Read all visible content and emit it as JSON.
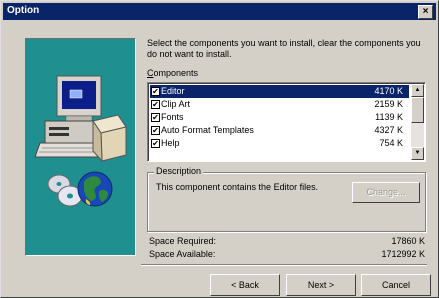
{
  "window": {
    "title": "Option",
    "close_glyph": "×"
  },
  "instructions": "Select the components you want to install, clear the components you do not want to install.",
  "components": {
    "label": "Components",
    "items": [
      {
        "name": "Editor",
        "size": "4170 K",
        "checked": true,
        "selected": true
      },
      {
        "name": "Clip Art",
        "size": "2159 K",
        "checked": true,
        "selected": false
      },
      {
        "name": "Fonts",
        "size": "1139 K",
        "checked": true,
        "selected": false
      },
      {
        "name": "Auto Format Templates",
        "size": "4327 K",
        "checked": true,
        "selected": false
      },
      {
        "name": "Help",
        "size": "754 K",
        "checked": true,
        "selected": false
      }
    ]
  },
  "description": {
    "legend": "Description",
    "text": "This component contains the Editor files.",
    "change_label": "Change..."
  },
  "space": {
    "required_label": "Space Required:",
    "required_value": "17860 K",
    "available_label": "Space Available:",
    "available_value": "1712992 K"
  },
  "buttons": {
    "back": "< Back",
    "next": "Next >",
    "cancel": "Cancel"
  }
}
